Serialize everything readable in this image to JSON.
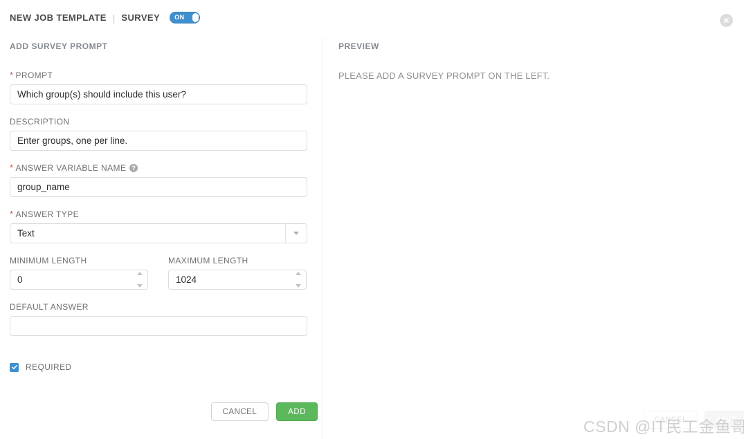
{
  "header": {
    "title": "NEW JOB TEMPLATE",
    "separator": "|",
    "subtitle": "SURVEY",
    "toggle_label": "ON",
    "toggle_state": "on"
  },
  "close_button": {
    "name": "close-icon"
  },
  "left_panel": {
    "section_title": "ADD SURVEY PROMPT",
    "fields": [
      {
        "label": "PROMPT",
        "required": true,
        "value": "Which group(s) should include this user?",
        "placeholder": ""
      },
      {
        "label": "DESCRIPTION",
        "required": false,
        "value": "Enter groups, one per line.",
        "placeholder": ""
      },
      {
        "label": "ANSWER VARIABLE NAME",
        "required": true,
        "has_help": true,
        "help_glyph": "?",
        "value": "group_name",
        "placeholder": ""
      },
      {
        "label": "ANSWER TYPE",
        "required": true,
        "value": "Text",
        "type": "select"
      },
      {
        "label": "MINIMUM LENGTH",
        "required": false,
        "value": "0",
        "type": "number"
      },
      {
        "label": "MAXIMUM LENGTH",
        "required": false,
        "value": "1024",
        "type": "number"
      },
      {
        "label": "DEFAULT ANSWER",
        "required": false,
        "value": "",
        "placeholder": ""
      }
    ],
    "required_checkbox": {
      "label": "REQUIRED",
      "checked": true
    },
    "buttons": {
      "cancel": "CANCEL",
      "add": "ADD"
    }
  },
  "right_panel": {
    "section_title": "PREVIEW",
    "empty_message": "PLEASE ADD A SURVEY PROMPT ON THE LEFT."
  },
  "background_buttons": {
    "cancel": "CANCEL",
    "save": "SAVE"
  },
  "watermark": "CSDN @IT民工金鱼哥",
  "colors": {
    "accent_blue": "#3f8fce",
    "add_green": "#5cb85c",
    "required_red": "#d9534f",
    "label_gray": "#707070",
    "border_gray": "#dcdcdc"
  }
}
